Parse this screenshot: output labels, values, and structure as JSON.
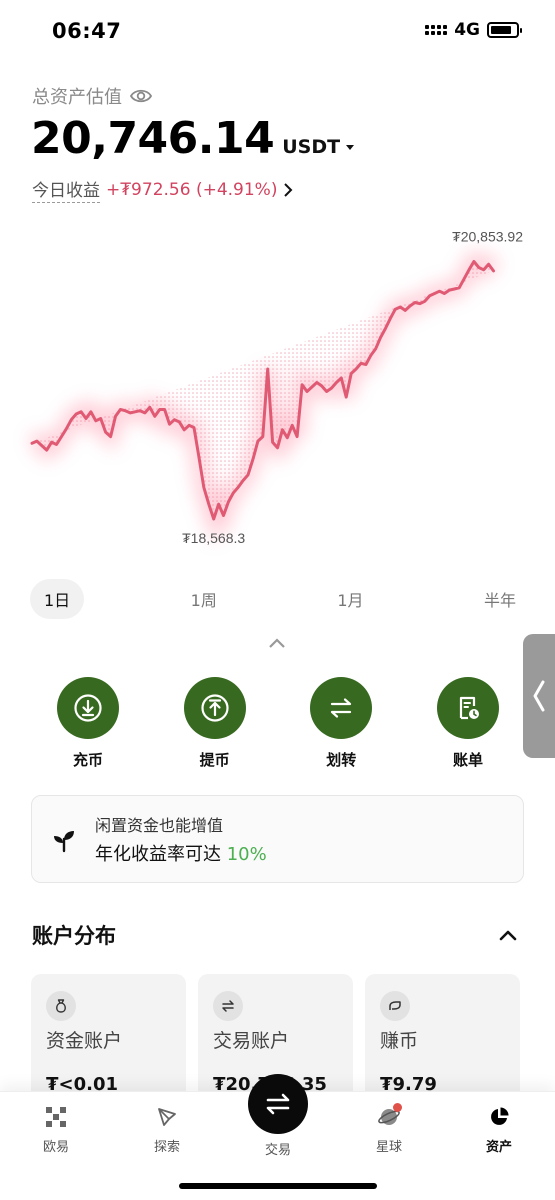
{
  "status_bar": {
    "time": "06:47",
    "network": "4G",
    "battery_level": 0.85
  },
  "header": {
    "asset_label": "总资产估值",
    "asset_value": "20,746.14",
    "asset_unit": "USDT",
    "pnl_label": "今日收益",
    "pnl_value": "+₮972.56 (+4.91%)"
  },
  "chart_data": {
    "type": "line",
    "x": [
      0,
      1,
      2,
      3,
      4,
      5,
      6,
      7,
      8,
      9,
      10,
      11,
      12,
      13,
      14,
      15,
      16,
      17,
      18,
      19,
      20,
      21,
      22,
      23,
      24,
      25,
      26,
      27,
      28,
      29,
      30,
      31,
      32,
      33,
      34,
      35,
      36,
      37,
      38,
      39,
      40,
      41,
      42,
      43,
      44,
      45,
      46,
      47,
      48,
      49,
      50,
      51,
      52,
      53,
      54,
      55,
      56,
      57,
      58,
      59,
      60,
      61,
      62,
      63,
      64,
      65,
      66,
      67,
      68,
      69,
      70,
      71,
      72,
      73,
      74,
      75,
      76,
      77,
      78,
      79,
      80,
      81,
      82,
      83,
      84,
      85,
      86,
      87,
      88,
      89,
      90,
      91,
      92,
      93,
      94,
      95,
      96,
      97,
      98,
      99,
      100
    ],
    "y": [
      19240,
      19260,
      19220,
      19180,
      19250,
      19230,
      19300,
      19370,
      19450,
      19500,
      19520,
      19460,
      19520,
      19440,
      19460,
      19340,
      19300,
      19480,
      19540,
      19530,
      19510,
      19520,
      19530,
      19510,
      19560,
      19480,
      19540,
      19540,
      19410,
      19450,
      19430,
      19360,
      19400,
      19380,
      19120,
      18850,
      18700,
      18568.3,
      18700,
      18600,
      18720,
      18800,
      18850,
      18910,
      18960,
      19100,
      19260,
      19300,
      19900,
      19250,
      19200,
      19360,
      19290,
      19400,
      19300,
      19760,
      19700,
      19740,
      19780,
      19750,
      19700,
      19730,
      19780,
      19820,
      19650,
      19860,
      19900,
      19950,
      19940,
      20020,
      20080,
      20180,
      20260,
      20350,
      20430,
      20450,
      20420,
      20460,
      20490,
      20480,
      20500,
      20550,
      20570,
      20590,
      20570,
      20600,
      20610,
      20620,
      20700,
      20780,
      20853.92,
      20800,
      20780,
      20830,
      20770
    ],
    "ylim": [
      18400,
      21000
    ],
    "max_label": "₮20,853.92",
    "min_label": "₮18,568.3",
    "line_color": "#e05a74",
    "grid": false
  },
  "periods": [
    "1日",
    "1周",
    "1月",
    "半年"
  ],
  "active_period": 0,
  "actions": [
    {
      "label": "充币",
      "icon": "deposit-icon"
    },
    {
      "label": "提币",
      "icon": "withdraw-icon"
    },
    {
      "label": "划转",
      "icon": "transfer-icon"
    },
    {
      "label": "账单",
      "icon": "bill-icon"
    }
  ],
  "action_color": "#376a20",
  "promo": {
    "line1": "闲置资金也能增值",
    "line2_prefix": "年化收益率可达 ",
    "line2_rate": "10%",
    "rate_color": "#4caf50"
  },
  "accounts_section": {
    "title": "账户分布",
    "cards": [
      {
        "name": "资金账户",
        "value": "₮<0.01",
        "icon": "bag-icon"
      },
      {
        "name": "交易账户",
        "value": "₮20,746.35",
        "icon": "swap-icon"
      },
      {
        "name": "赚币",
        "value": "₮9.79",
        "icon": "earn-icon"
      }
    ]
  },
  "bottom_nav": [
    {
      "label": "欧易",
      "icon": "okx-logo-icon"
    },
    {
      "label": "探索",
      "icon": "compass-icon"
    },
    {
      "label": "交易",
      "icon": "trade-swap-icon"
    },
    {
      "label": "星球",
      "icon": "planet-icon"
    },
    {
      "label": "资产",
      "icon": "pie-chart-icon"
    }
  ],
  "active_nav": 4
}
